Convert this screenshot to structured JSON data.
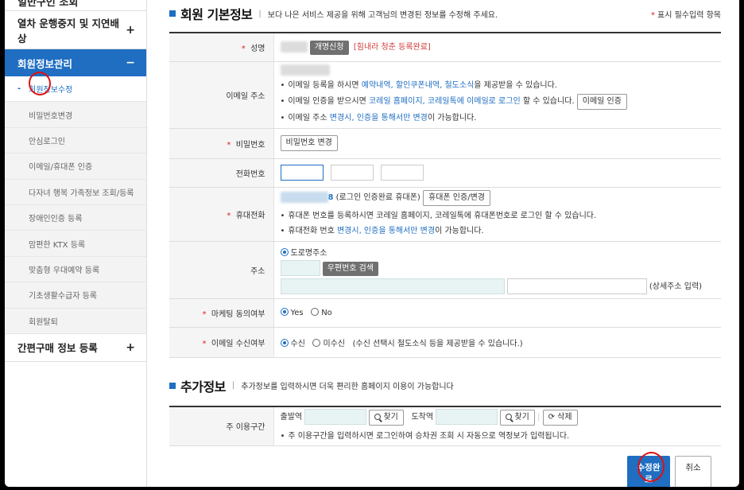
{
  "sidebar": {
    "cut_top": "일반구인 조회",
    "sections": [
      {
        "label": "열차 운행중지 및 지연배상",
        "sign": "+"
      },
      {
        "label": "회원정보관리",
        "sign": "−"
      }
    ],
    "sub_items": [
      "회원정보수정",
      "비밀번호변경",
      "안심로그인",
      "이메일/휴대폰 인증",
      "다자녀 행복 가족정보 조회/등록",
      "장애인인증 등록",
      "맘편한 KTX 등록",
      "맞춤형 우대예약 등록",
      "기초생활수급자 등록",
      "회원탈퇴"
    ],
    "bottom_section": {
      "label": "간편구매 정보 등록",
      "sign": "+"
    }
  },
  "basic": {
    "title": "회원 기본정보",
    "sep": "|",
    "desc": "보다 나은 서비스 제공을 위해 고객님의 변경된 정보를 수정해 주세요.",
    "req_star": "*",
    "req_note": "표시 필수입력 항목"
  },
  "form": {
    "name": {
      "label": "성명",
      "btn": "개명신청",
      "badge": "[힘내라 청춘 등록완료]"
    },
    "email": {
      "label": "이메일 주소",
      "l1_pre": "이메일 등록을 하시면 ",
      "l1_link": "예약내역, 할인쿠폰내역, 철도소식",
      "l1_post": "을 제공받을 수 있습니다.",
      "l2_pre": "이메일 인증을 받으시면 ",
      "l2_link": "코레일 홈페이지, 코레일톡에 이메일로 로그인",
      "l2_post": " 할 수 있습니다.",
      "btn": "이메일 인증",
      "l3_pre": "이메일 주소 ",
      "l3_link": "변경시, 인증을 통해서만 변경",
      "l3_post": "이 가능합니다."
    },
    "password": {
      "label": "비밀번호",
      "btn": "비밀번호 변경"
    },
    "phone": {
      "label": "전화번호"
    },
    "mobile": {
      "label": "휴대전화",
      "digit": "8",
      "status": "(로그인 인증완료 휴대폰)",
      "btn": "휴대폰 인증/변경",
      "l1": "휴대폰 번호를 등록하시면 코레일 홈페이지, 코레일톡에 휴대폰번호로 로그인 할 수 있습니다.",
      "l2_pre": "휴대전화 번호 ",
      "l2_link": "변경시, 인증을 통해서만 변경",
      "l2_post": "이 가능합니다."
    },
    "address": {
      "label": "주소",
      "radio": "도로명주소",
      "btn": "우편번호 검색",
      "detail_hint": "(상세주소 입력)"
    },
    "marketing": {
      "label": "마케팅 동의여부",
      "yes": "Yes",
      "no": "No"
    },
    "email_recv": {
      "label": "이메일 수신여부",
      "yes": "수신",
      "no": "미수신",
      "note": "(수신 선택시 철도소식 등을 제공받을 수 있습니다.)"
    }
  },
  "extra": {
    "title": "추가정보",
    "sep": "|",
    "desc": "추가정보를 입력하시면 더욱 편리한 홈페이지 이용이 가능합니다",
    "route_label": "주 이용구간",
    "dep": "출발역",
    "arr": "도착역",
    "find": "찾기",
    "delete": "삭제",
    "note": "주 이용구간을 입력하시면 로그인하여 승차권 조회 시 자동으로 역정보가 입력됩니다."
  },
  "actions": {
    "submit": "수정완료",
    "cancel": "취소"
  }
}
